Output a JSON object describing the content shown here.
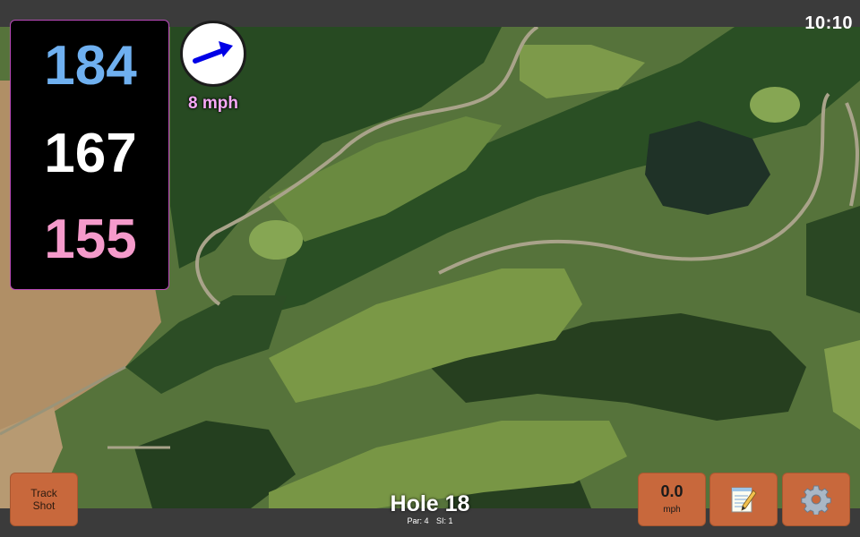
{
  "status_bar": {
    "time": "10:10"
  },
  "distances": {
    "back": "184",
    "middle": "167",
    "front": "155",
    "colors": {
      "back": "#6fb0f0",
      "middle": "#ffffff",
      "front": "#f59acb"
    }
  },
  "wind": {
    "speed_label": "8 mph",
    "icon": "wind-direction-arrow-icon",
    "arrow_color": "#0000e6"
  },
  "hole": {
    "title": "Hole 18",
    "par_label": "Par: 4",
    "si_label": "SI: 1"
  },
  "buttons": {
    "track_shot_line1": "Track",
    "track_shot_line2": "Shot",
    "speed_value": "0.0",
    "speed_unit": "mph",
    "notes_icon": "notepad-icon",
    "settings_icon": "gear-icon"
  },
  "theme": {
    "button_color": "#c8683c",
    "panel_border": "#b84ab8"
  }
}
